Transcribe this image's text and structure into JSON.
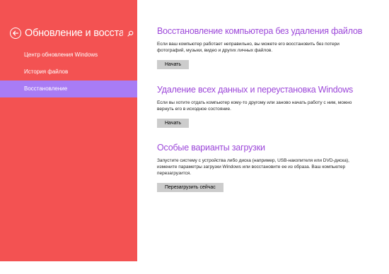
{
  "sidebar": {
    "title": "Обновление и восстан...",
    "back_icon": "back-arrow-circle-icon",
    "search_icon": "search-icon",
    "items": [
      {
        "label": "Центр обновления Windows",
        "selected": false
      },
      {
        "label": "История файлов",
        "selected": false
      },
      {
        "label": "Восстановление",
        "selected": true
      }
    ]
  },
  "main": {
    "sections": [
      {
        "title": "Восстановление компьютера без удаления файлов",
        "description": "Если ваш компьютер работает неправильно, вы можете его восстановить без потери фотографий, музыки, видео и других личных файлов.",
        "button": "Начать"
      },
      {
        "title": "Удаление всех данных и переустановка Windows",
        "description": "Если вы хотите отдать компьютер кому-то другому или заново начать работу с ним, можно вернуть его в исходное состояние.",
        "button": "Начать"
      },
      {
        "title": "Особые варианты загрузки",
        "description": "Запустите систему с устройства либо диска (например, USB-накопителя или DVD-диска), измените параметры загрузки Windows или восстановите ее из образа. Ваш компьютер перезагрузится.",
        "button": "Перезагрузить сейчас"
      }
    ]
  },
  "colors": {
    "sidebar_bg": "#f35252",
    "selected_bg": "#a87cf5",
    "heading": "#9c47d9",
    "button_bg": "#cccccc"
  }
}
